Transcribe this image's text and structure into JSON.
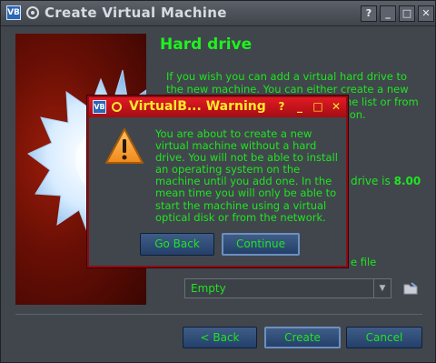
{
  "window": {
    "title": "Create Virtual Machine",
    "controls": [
      "?",
      "_",
      "□",
      "✕"
    ]
  },
  "page": {
    "heading": "Hard drive",
    "intro": "If you wish you can add a virtual hard drive to the new machine. You can either create a new hard drive file or select one from the list or from another location using the folder icon.",
    "size_prefix": "drive is",
    "size_value": "8.00",
    "file_label": "e file",
    "combo_value": "Empty"
  },
  "buttons": {
    "back": "< Back",
    "create": "Create",
    "cancel": "Cancel"
  },
  "dialog": {
    "title": "VirtualB... Warning",
    "controls": [
      "?",
      "_",
      "□",
      "✕"
    ],
    "message": "You are about to create a new virtual machine without a hard drive. You will not be able to install an operating system on the machine until you add one. In the mean time you will only be able to start the machine using a virtual optical disk or from the network.",
    "go_back": "Go Back",
    "continue": "Continue"
  },
  "colors": {
    "text_green": "#1ee61e",
    "dialog_title_red": "#c8141c",
    "dialog_title_text": "#ffe82a"
  }
}
